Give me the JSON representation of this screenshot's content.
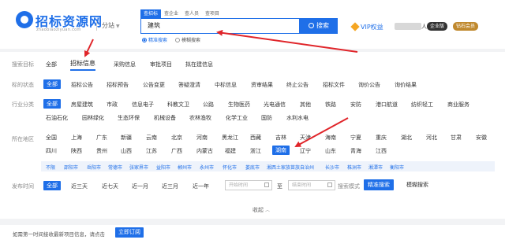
{
  "header": {
    "logo_text": "招标资源网",
    "logo_sub": "zhaobiaoziyuan.com",
    "site_switch": "分站",
    "search_tabs": [
      "查招标",
      "查企业",
      "查人员",
      "查项目"
    ],
    "search_value": "建筑",
    "search_button": "搜索",
    "search_mode": [
      "精准搜索",
      "模糊搜索"
    ],
    "vip_label": "VIP权益",
    "user_suffix": "人",
    "badge_enterprise": "企业版",
    "badge_diamond": "钻石会员"
  },
  "filters": {
    "target": {
      "label": "搜索目标",
      "options": [
        "全部",
        "招标信息",
        "采购信息",
        "审批项目",
        "拟在建信息"
      ]
    },
    "status": {
      "label": "标的状态",
      "options": [
        "全部",
        "招标公告",
        "招标预告",
        "公告变更",
        "答疑澄清",
        "中标信息",
        "资审结果",
        "终止公告",
        "招标文件",
        "询价公告",
        "询价结果"
      ]
    },
    "industry": {
      "label": "行业分类",
      "options_row1": [
        "全部",
        "房屋建筑",
        "市政",
        "信息电子",
        "科教文卫",
        "公路",
        "生物医药",
        "光电通信",
        "其他",
        "铁路",
        "安防",
        "港口航道",
        "纺织轻工",
        "商业服务"
      ],
      "options_row2": [
        "石油石化",
        "园林绿化",
        "生态环保",
        "机械设备",
        "农林渔牧",
        "化学工业",
        "国防",
        "水利水电"
      ]
    },
    "region": {
      "label": "所在地区",
      "options_row1": [
        "全国",
        "上海",
        "广东",
        "新疆",
        "云南",
        "北京",
        "河南",
        "黑龙江",
        "西藏",
        "吉林",
        "天津",
        "海南",
        "宁夏",
        "重庆",
        "湖北",
        "河北",
        "甘肃",
        "安徽"
      ],
      "options_row2": [
        "四川",
        "陕西",
        "贵州",
        "山西",
        "江苏",
        "广西",
        "内蒙古",
        "福建",
        "浙江",
        "湖南",
        "辽宁",
        "山东",
        "青海",
        "江西"
      ],
      "cities": [
        "不限",
        "邵阳市",
        "岳阳市",
        "常德市",
        "张家界市",
        "益阳市",
        "郴州市",
        "永州市",
        "怀化市",
        "娄底市",
        "湘西土家族苗族自治州",
        "长沙市",
        "株洲市",
        "湘潭市",
        "衡阳市"
      ]
    },
    "time": {
      "label": "发布时间",
      "options": [
        "全部",
        "近三天",
        "近七天",
        "近一月",
        "近三月",
        "近一年"
      ],
      "start_placeholder": "开始时间",
      "to_label": "至",
      "end_placeholder": "结束时间",
      "mode_label": "搜索模式",
      "precise": "精准搜索",
      "fuzzy": "模糊搜索"
    }
  },
  "collapse_label": "收起",
  "notify": {
    "text": "如需第一时间接收最新项目信息，请点击",
    "button": "立即订阅"
  },
  "colors": {
    "accent": "#1f6fe8",
    "annotation_red": "#e0252a"
  }
}
